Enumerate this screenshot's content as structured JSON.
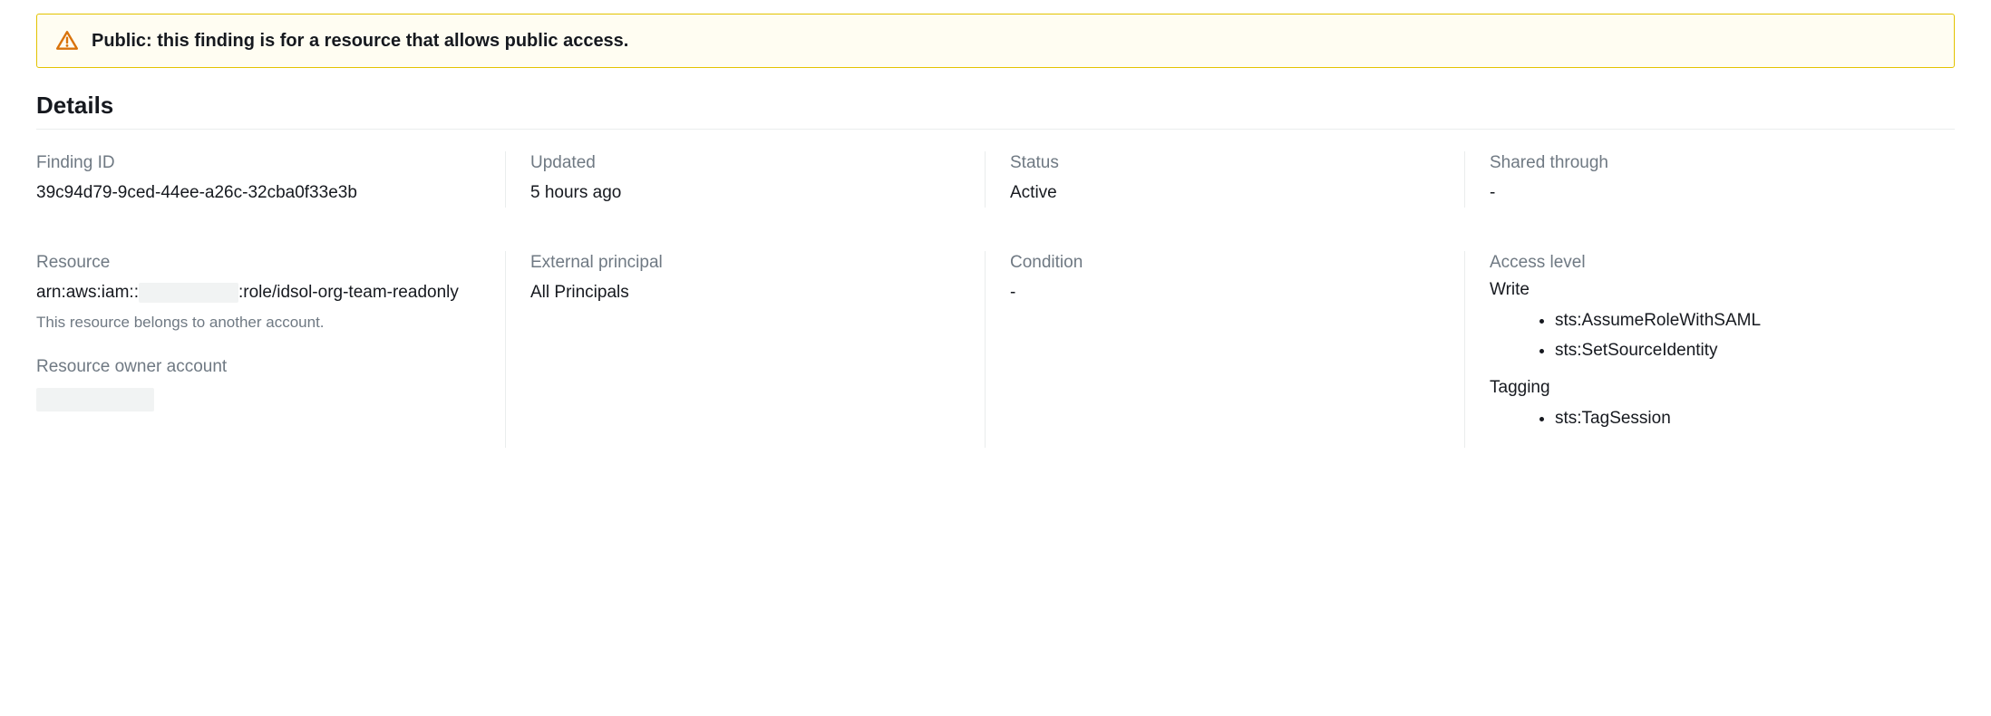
{
  "alert": {
    "text": "Public: this finding is for a resource that allows public access."
  },
  "section_title": "Details",
  "fields": {
    "finding_id": {
      "label": "Finding ID",
      "value": "39c94d79-9ced-44ee-a26c-32cba0f33e3b"
    },
    "updated": {
      "label": "Updated",
      "value": "5 hours ago"
    },
    "status": {
      "label": "Status",
      "value": "Active"
    },
    "shared_through": {
      "label": "Shared through",
      "value": "-"
    },
    "resource": {
      "label": "Resource",
      "prefix": "arn:aws:iam::",
      "suffix": ":role/idsol-org-team-readonly",
      "note": "This resource belongs to another account."
    },
    "resource_owner_account": {
      "label": "Resource owner account"
    },
    "external_principal": {
      "label": "External principal",
      "value": "All Principals"
    },
    "condition": {
      "label": "Condition",
      "value": "-"
    },
    "access_level": {
      "label": "Access level",
      "groups": {
        "write": {
          "label": "Write",
          "items": [
            "sts:AssumeRoleWithSAML",
            "sts:SetSourceIdentity"
          ]
        },
        "tagging": {
          "label": "Tagging",
          "items": [
            "sts:TagSession"
          ]
        }
      }
    }
  }
}
